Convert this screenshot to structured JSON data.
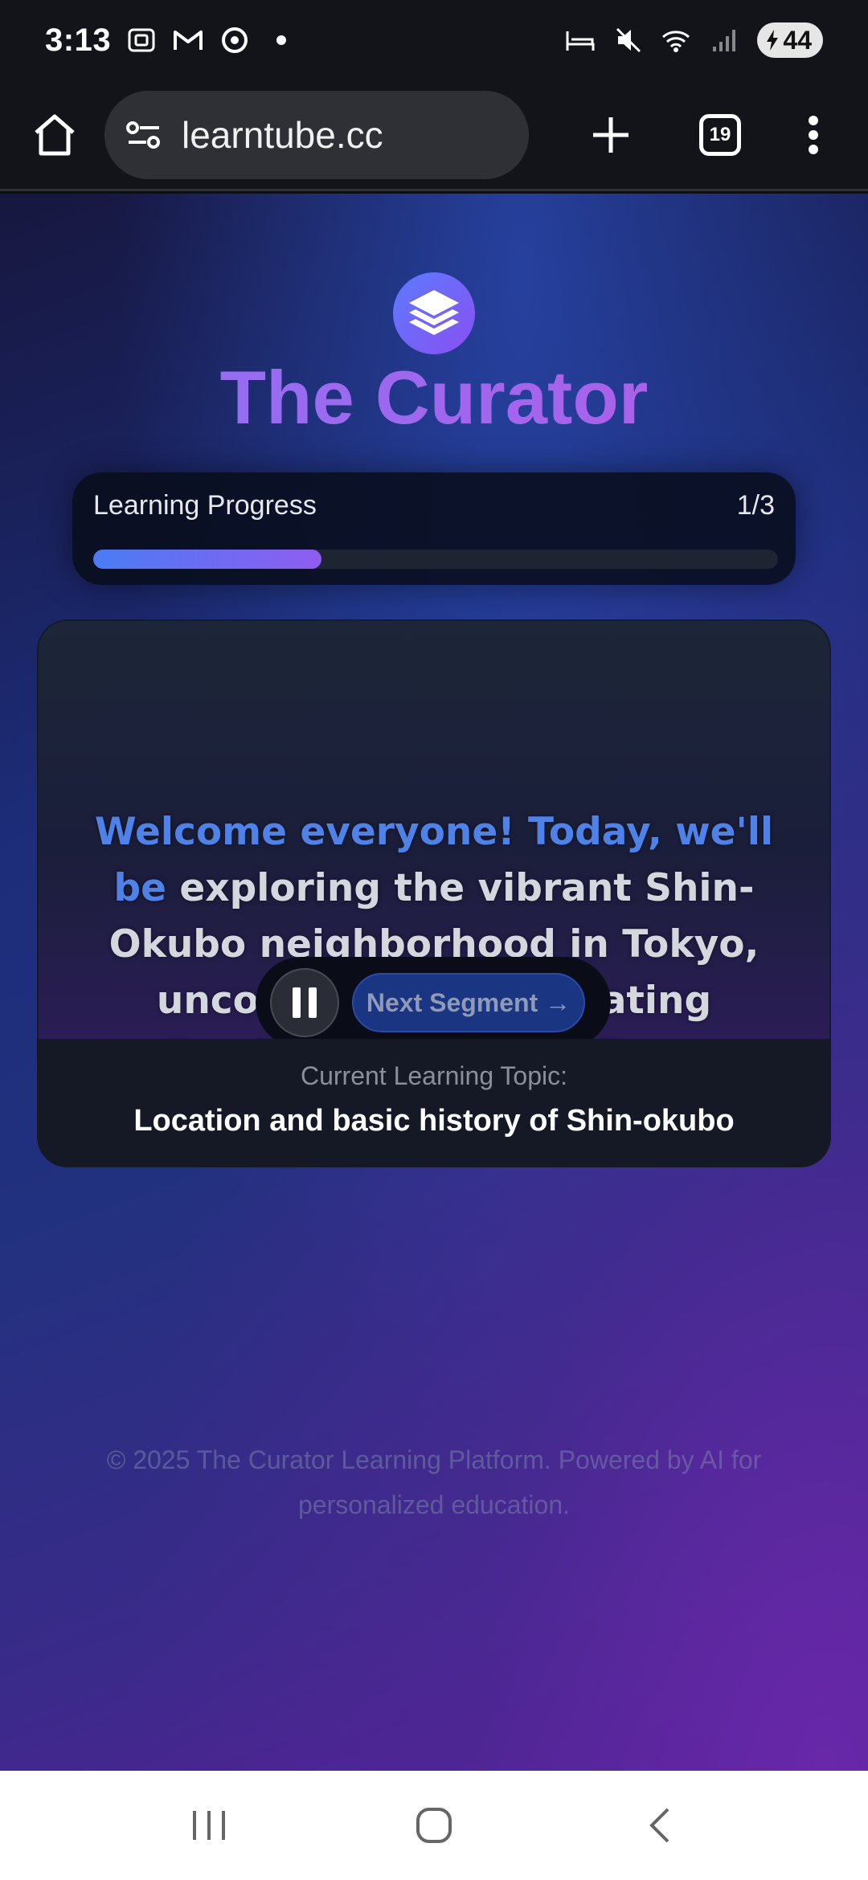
{
  "status_bar": {
    "time": "3:13",
    "battery": "44",
    "icons_left": [
      "screenshot-icon",
      "gmail-icon",
      "chrome-icon",
      "dot-icon"
    ],
    "icons_right": [
      "sleep-mode-icon",
      "mute-icon",
      "wifi-icon",
      "signal-icon"
    ]
  },
  "browser": {
    "url": "learntube.cc",
    "tab_count": "19"
  },
  "app": {
    "title": "The Curator",
    "progress": {
      "label": "Learning Progress",
      "value_text": "1/3",
      "fraction": 0.333
    },
    "caption": {
      "highlight": "Welcome everyone!  Today, we'll be",
      "rest": "exploring the vibrant Shin-Okubo neighborhood in Tokyo, uncovering its fascinating location and rich history."
    },
    "controls": {
      "next_label": "Next Segment →"
    },
    "topic": {
      "label": "Current Learning Topic:",
      "value": "Location and basic history of Shin-okubo"
    },
    "footer": "© 2025 The Curator Learning Platform. Powered by AI for personalized education."
  },
  "colors": {
    "accent_blue": "#4f82e8",
    "accent_purple": "#8f5cf0",
    "title_gradient_start": "#8b73f5",
    "title_gradient_end": "#b45be6"
  }
}
